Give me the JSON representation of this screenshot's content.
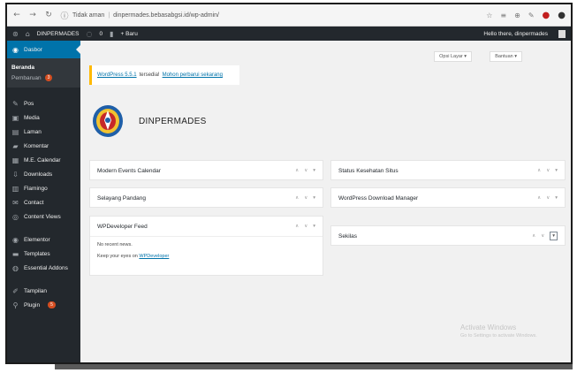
{
  "browser": {
    "url_security": "Tidak aman",
    "url_text": "dinpermades.bebasabgsi.id/wp-admin/",
    "back_icon": "back-arrow-icon",
    "forward_icon": "forward-arrow-icon",
    "reload_icon": "reload-icon",
    "info_icon": "info-icon"
  },
  "adminbar": {
    "site": "DINPERMADES",
    "comments_count": "0",
    "new_label": "+ Baru",
    "howdy": "Hello there, dinpermades"
  },
  "sidebar": {
    "active": "Dasbor",
    "submenu": [
      "Beranda",
      "Pembaruan"
    ],
    "submenu_badge": "3",
    "items": [
      {
        "label": "Pos",
        "icon": "pin-icon"
      },
      {
        "label": "Media",
        "icon": "media-icon"
      },
      {
        "label": "Laman",
        "icon": "page-icon"
      },
      {
        "label": "Komentar",
        "icon": "comment-icon"
      },
      {
        "label": "M.E. Calendar",
        "icon": "calendar-icon"
      },
      {
        "label": "Downloads",
        "icon": "download-icon"
      },
      {
        "label": "Flamingo",
        "icon": "flamingo-icon"
      },
      {
        "label": "Contact",
        "icon": "mail-icon"
      },
      {
        "label": "Content Views",
        "icon": "views-icon"
      },
      {
        "label": "Elementor",
        "icon": "elementor-icon"
      },
      {
        "label": "Templates",
        "icon": "templates-icon"
      },
      {
        "label": "Essential Addons",
        "icon": "addons-icon"
      },
      {
        "label": "Tampilan",
        "icon": "brush-icon"
      },
      {
        "label": "Plugin",
        "icon": "plugin-icon"
      }
    ],
    "plugin_badge": "5"
  },
  "screen_options": "Opsi Layar ▾",
  "help": "Bantuan ▾",
  "notice": {
    "link1": "WordPress 5.5.1",
    "middle": "tersedia!",
    "link2": "Mohon perbarui sekarang"
  },
  "site_name": "DINPERMADES",
  "widgets": {
    "mec": "Modern Events Calendar",
    "selayang": "Selayang Pandang",
    "wpdevelopers": "WPDeveloper Feed",
    "wpdev_body1": "No recent news.",
    "wpdev_body2": "Keep your eyes on",
    "wpdev_link": "WPDeveloper",
    "status": "Status Kesehatan Situs",
    "wpdm": "WordPress Download Manager",
    "ringkas": "Sekilas"
  },
  "watermark": {
    "title": "Activate Windows",
    "subtitle": "Go to Settings to activate Windows."
  },
  "colors": {
    "admin_dark": "#23282d",
    "accent_blue": "#0073aa",
    "notice_yellow": "#ffb900",
    "badge_orange": "#d54e21"
  }
}
